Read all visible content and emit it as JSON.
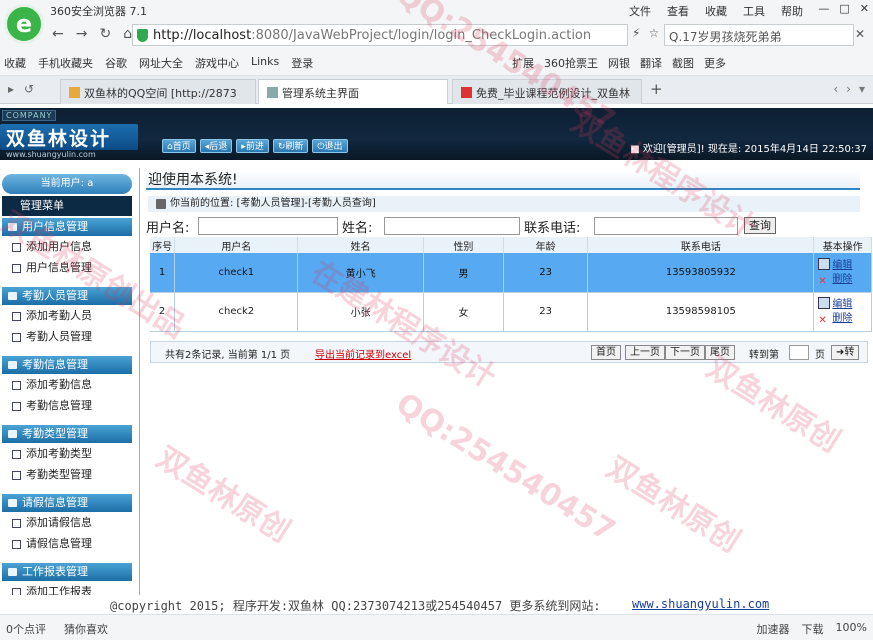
{
  "browser": {
    "title": "360安全浏览器 7.1",
    "menu": [
      "文件",
      "查看",
      "收藏",
      "工具",
      "帮助"
    ],
    "url_host": "http://localhost",
    "url_rest": ":8080/JavaWebProject/login/login_CheckLogin.action",
    "search_text": "Q.17岁男孩烧死弟弟",
    "bookmarks_left": [
      "收藏",
      "手机收藏夹",
      "谷歌",
      "网址大全",
      "游戏中心",
      "Links",
      "登录"
    ],
    "bookmarks_right": [
      "扩展",
      "360抢票王",
      "网银",
      "翻译",
      "截图",
      "更多"
    ],
    "tabs": [
      {
        "label": "双鱼林的QQ空间 [http://2873"
      },
      {
        "label": "管理系统主界面"
      },
      {
        "label": "免费_毕业课程范例设计_双鱼林"
      }
    ],
    "status_left": [
      "0个点评",
      "猜你喜欢"
    ],
    "status_right": [
      "加速器",
      "下载",
      "100%"
    ]
  },
  "app": {
    "company": "COMPANY",
    "brand": "双鱼林设计",
    "site": "www.shuangyulin.com",
    "nav": [
      "首页",
      "后退",
      "前进",
      "刷新",
      "退出"
    ],
    "welcome": "欢迎[管理员]!  现在是: 2015年4月14日 22:50:37",
    "sidebar": {
      "current_user": "当前用户: a",
      "menu_title": "管理菜单",
      "groups": [
        {
          "title": "用户信息管理",
          "items": [
            "添加用户信息",
            "用户信息管理"
          ]
        },
        {
          "title": "考勤人员管理",
          "items": [
            "添加考勤人员",
            "考勤人员管理"
          ]
        },
        {
          "title": "考勤信息管理",
          "items": [
            "添加考勤信息",
            "考勤信息管理"
          ]
        },
        {
          "title": "考勤类型管理",
          "items": [
            "添加考勤类型",
            "考勤类型管理"
          ]
        },
        {
          "title": "请假信息管理",
          "items": [
            "添加请假信息",
            "请假信息管理"
          ]
        },
        {
          "title": "工作报表管理",
          "items": [
            "添加工作报表"
          ]
        }
      ]
    },
    "main": {
      "marquee": "迎使用本系统!",
      "location": "你当前的位置: [考勤人员管理]-[考勤人员查询]",
      "search_labels": [
        "用户名:",
        "姓名:",
        "联系电话:"
      ],
      "query_button": "查询",
      "columns": [
        "序号",
        "用户名",
        "姓名",
        "性别",
        "年龄",
        "联系电话",
        "基本操作"
      ],
      "rows": [
        [
          "1",
          "check1",
          "黄小飞",
          "男",
          "23",
          "13593805932"
        ],
        [
          "2",
          "check2",
          "小张",
          "女",
          "23",
          "13598598105"
        ]
      ],
      "op_edit": "编辑",
      "op_delete": "删除",
      "pager_info": "共有2条记录, 当前第 1/1 页",
      "export_link": "导出当前记录到excel",
      "pager_buttons": [
        "首页",
        "上一页",
        "下一页",
        "尾页"
      ],
      "goto_label": "转到第",
      "page_unit": "页",
      "go_button": "转"
    },
    "footer": {
      "copyright": "@copyright 2015; 程序开发:双鱼林   QQ:2373074213或254540457   更多系统到网站:",
      "link": "www.shuangyulin.com"
    }
  },
  "watermark": {
    "texts": [
      "双鱼林原创",
      "QQ:254540457",
      "在建林程序设计",
      "双鱼林程序设计",
      "双鱼林原创出品"
    ]
  }
}
